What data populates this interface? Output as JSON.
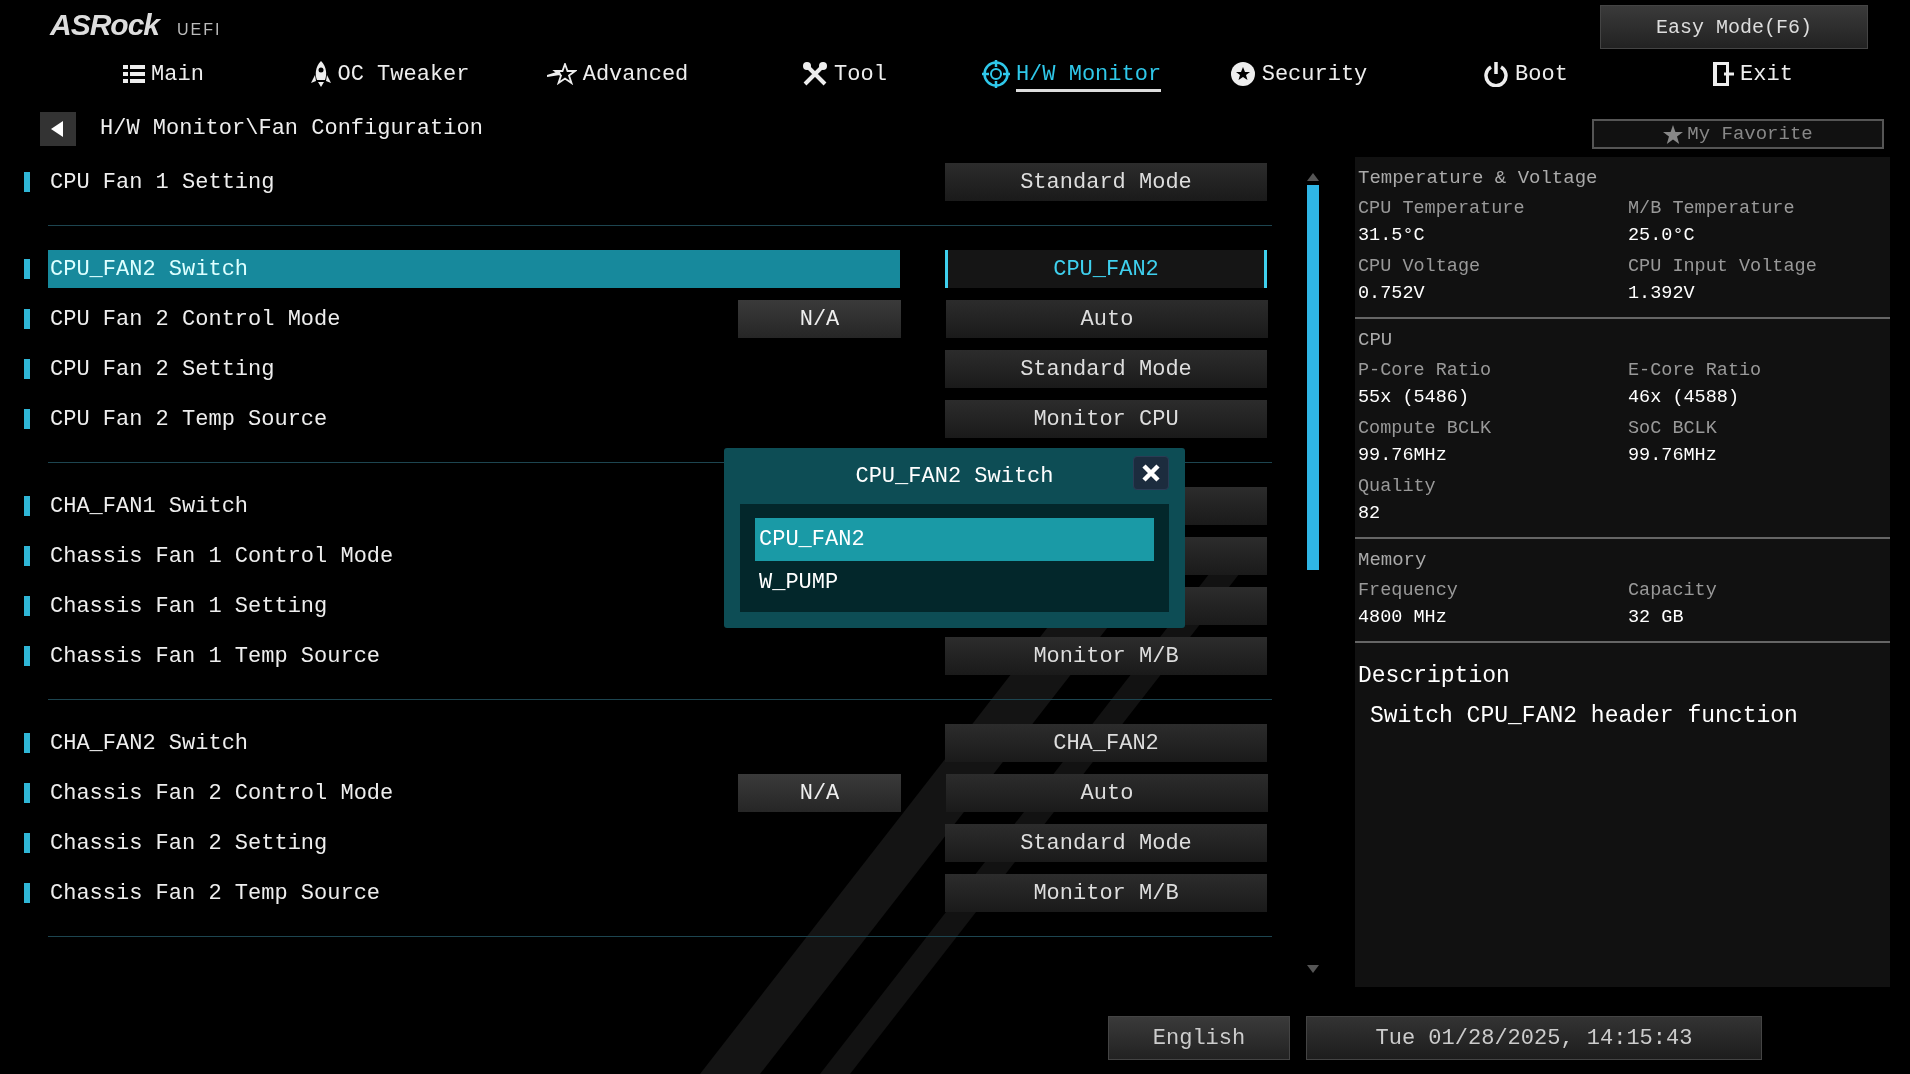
{
  "logo": {
    "brand": "ASRock",
    "tag": "UEFI"
  },
  "easy_mode_button": "Easy Mode(F6)",
  "tabs": [
    {
      "label": "Main",
      "selected": false
    },
    {
      "label": "OC Tweaker",
      "selected": false
    },
    {
      "label": "Advanced",
      "selected": false
    },
    {
      "label": "Tool",
      "selected": false
    },
    {
      "label": "H/W Monitor",
      "selected": true
    },
    {
      "label": "Security",
      "selected": false
    },
    {
      "label": "Boot",
      "selected": false
    },
    {
      "label": "Exit",
      "selected": false
    }
  ],
  "breadcrumb": "H/W Monitor\\Fan Configuration",
  "favorite_button": "My Favorite",
  "settings_groups": [
    {
      "items": [
        {
          "label": "CPU Fan 1 Setting",
          "value": "Standard Mode",
          "selected": false
        }
      ]
    },
    {
      "items": [
        {
          "label": "CPU_FAN2 Switch",
          "value": "CPU_FAN2",
          "selected": true
        },
        {
          "label": "CPU Fan 2 Control Mode",
          "extra": "N/A",
          "value": "Auto",
          "selected": false
        },
        {
          "label": "CPU Fan 2 Setting",
          "value": "Standard Mode",
          "selected": false
        },
        {
          "label": "CPU Fan 2 Temp Source",
          "value": "Monitor CPU",
          "selected": false
        }
      ]
    },
    {
      "items": [
        {
          "label": "CHA_FAN1 Switch",
          "selected": false
        },
        {
          "label": "Chassis Fan 1 Control Mode",
          "selected": false
        },
        {
          "label": "Chassis Fan 1 Setting",
          "selected": false
        },
        {
          "label": "Chassis Fan 1 Temp Source",
          "value": "Monitor M/B",
          "selected": false
        }
      ]
    },
    {
      "items": [
        {
          "label": "CHA_FAN2 Switch",
          "value": "CHA_FAN2",
          "selected": false
        },
        {
          "label": "Chassis Fan 2 Control Mode",
          "extra": "N/A",
          "value": "Auto",
          "selected": false
        },
        {
          "label": "Chassis Fan 2 Setting",
          "value": "Standard Mode",
          "selected": false
        },
        {
          "label": "Chassis Fan 2 Temp Source",
          "value": "Monitor M/B",
          "selected": false
        }
      ]
    }
  ],
  "popup": {
    "title": "CPU_FAN2 Switch",
    "options": [
      {
        "label": "CPU_FAN2",
        "selected": true
      },
      {
        "label": "W_PUMP",
        "selected": false
      }
    ]
  },
  "info_panel": {
    "sections": [
      {
        "title": "Temperature & Voltage",
        "fields": [
          {
            "label": "CPU Temperature",
            "value": "31.5°C"
          },
          {
            "label": "M/B Temperature",
            "value": "25.0°C"
          },
          {
            "label": "CPU Voltage",
            "value": "0.752V"
          },
          {
            "label": "CPU Input Voltage",
            "value": "1.392V"
          }
        ]
      },
      {
        "title": "CPU",
        "fields": [
          {
            "label": "P-Core Ratio",
            "value": "55x (5486)"
          },
          {
            "label": "E-Core Ratio",
            "value": "46x (4588)"
          },
          {
            "label": "Compute BCLK",
            "value": "99.76MHz"
          },
          {
            "label": "SoC BCLK",
            "value": "99.76MHz"
          },
          {
            "label": "Quality",
            "value": "82"
          }
        ]
      },
      {
        "title": "Memory",
        "fields": [
          {
            "label": "Frequency",
            "value": "4800 MHz"
          },
          {
            "label": "Capacity",
            "value": "32 GB"
          }
        ]
      }
    ]
  },
  "description": {
    "title": "Description",
    "text": "Switch CPU_FAN2 header function"
  },
  "language_button": "English",
  "datetime": "Tue 01/28/2025, 14:15:43"
}
